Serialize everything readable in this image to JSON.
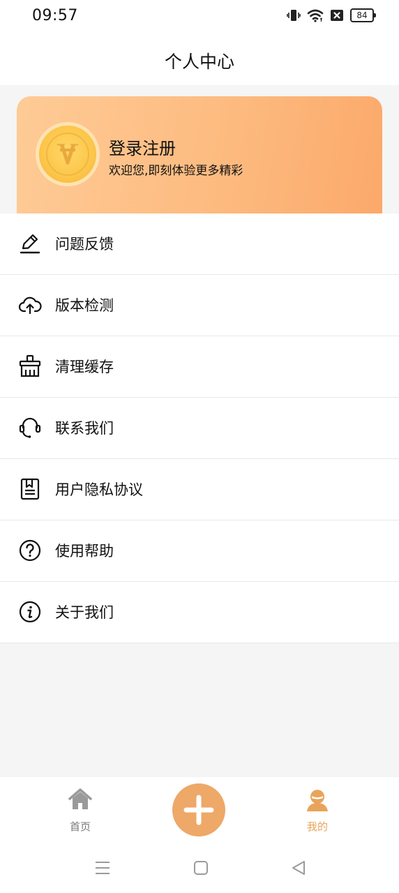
{
  "status_bar": {
    "time": "09:57",
    "battery": "84",
    "icons": [
      "vibrate-icon",
      "wifi-icon",
      "sim-off-icon",
      "battery-icon"
    ]
  },
  "header": {
    "title": "个人中心"
  },
  "profile": {
    "title": "登录注册",
    "subtitle": "欢迎您,即刻体验更多精彩",
    "avatar_icon": "v-logo-icon",
    "gradient_colors": [
      "#fecb96",
      "#fba96a"
    ]
  },
  "menu": {
    "items": [
      {
        "label": "问题反馈",
        "icon": "edit-pen-icon"
      },
      {
        "label": "版本检测",
        "icon": "cloud-upload-icon"
      },
      {
        "label": "清理缓存",
        "icon": "broom-icon"
      },
      {
        "label": "联系我们",
        "icon": "headset-icon"
      },
      {
        "label": "用户隐私协议",
        "icon": "document-icon"
      },
      {
        "label": "使用帮助",
        "icon": "help-circle-icon"
      },
      {
        "label": "关于我们",
        "icon": "info-circle-icon"
      }
    ]
  },
  "tab_bar": {
    "tabs": [
      {
        "label": "首页",
        "icon": "home-icon",
        "active": false
      },
      {
        "label": "我的",
        "icon": "user-icon",
        "active": true
      }
    ],
    "fab_icon": "plus-icon",
    "accent": "#eea868",
    "active_color": "#e8a45a"
  },
  "nav_bar": {
    "icons": [
      "menu-lines-icon",
      "home-square-icon",
      "back-triangle-icon"
    ]
  }
}
